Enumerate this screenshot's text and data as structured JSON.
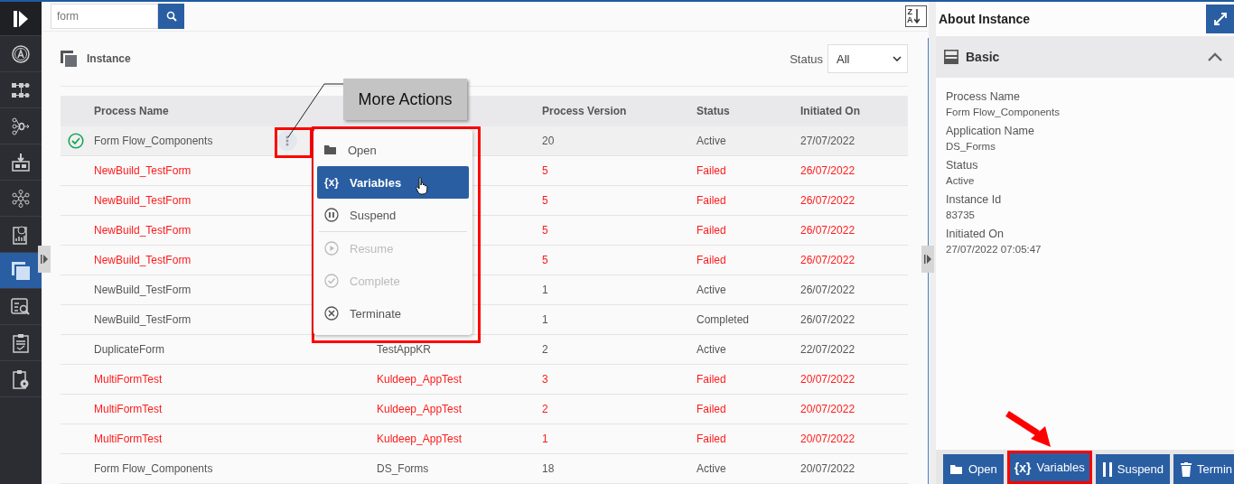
{
  "sidebar": {
    "items": [
      {
        "kind": "logo",
        "selected": false
      },
      {
        "kind": "apps",
        "selected": false
      },
      {
        "kind": "flow",
        "selected": false
      },
      {
        "kind": "branch",
        "selected": false
      },
      {
        "kind": "import",
        "selected": false
      },
      {
        "kind": "network",
        "selected": false
      },
      {
        "kind": "report",
        "selected": false
      },
      {
        "kind": "instance",
        "selected": true
      },
      {
        "kind": "audit",
        "selected": false
      },
      {
        "kind": "task",
        "selected": false
      },
      {
        "kind": "config",
        "selected": false
      }
    ]
  },
  "search": {
    "value": "form"
  },
  "sort_button": {
    "top": "Z",
    "bottom": "A"
  },
  "panel": {
    "title": "Instance",
    "status_label": "Status",
    "status_value": "All"
  },
  "table": {
    "columns": [
      "Process Name",
      null,
      "Process Version",
      "Status",
      "Initiated On"
    ],
    "rows": [
      {
        "selected": true,
        "failed": false,
        "cells": [
          "Form Flow_Components",
          null,
          "20",
          "Active",
          "27/07/2022"
        ]
      },
      {
        "selected": false,
        "failed": true,
        "cells": [
          "NewBuild_TestForm",
          null,
          "5",
          "Failed",
          "26/07/2022"
        ]
      },
      {
        "selected": false,
        "failed": true,
        "cells": [
          "NewBuild_TestForm",
          null,
          "5",
          "Failed",
          "26/07/2022"
        ]
      },
      {
        "selected": false,
        "failed": true,
        "cells": [
          "NewBuild_TestForm",
          null,
          "5",
          "Failed",
          "26/07/2022"
        ]
      },
      {
        "selected": false,
        "failed": true,
        "cells": [
          "NewBuild_TestForm",
          null,
          "5",
          "Failed",
          "26/07/2022"
        ]
      },
      {
        "selected": false,
        "failed": false,
        "cells": [
          "NewBuild_TestForm",
          null,
          "1",
          "Active",
          "26/07/2022"
        ]
      },
      {
        "selected": false,
        "failed": false,
        "cells": [
          "NewBuild_TestForm",
          null,
          "1",
          "Completed",
          "26/07/2022"
        ]
      },
      {
        "selected": false,
        "failed": false,
        "cells": [
          "DuplicateForm",
          "TestAppKR",
          "2",
          "Active",
          "22/07/2022"
        ]
      },
      {
        "selected": false,
        "failed": true,
        "cells": [
          "MultiFormTest",
          "Kuldeep_AppTest",
          "3",
          "Failed",
          "20/07/2022"
        ]
      },
      {
        "selected": false,
        "failed": true,
        "cells": [
          "MultiFormTest",
          "Kuldeep_AppTest",
          "2",
          "Failed",
          "20/07/2022"
        ]
      },
      {
        "selected": false,
        "failed": true,
        "cells": [
          "MultiFormTest",
          "Kuldeep_AppTest",
          "1",
          "Failed",
          "20/07/2022"
        ]
      },
      {
        "selected": false,
        "failed": false,
        "cells": [
          "Form Flow_Components",
          "DS_Forms",
          "18",
          "Active",
          "20/07/2022"
        ]
      }
    ]
  },
  "callout": "More Actions",
  "menu": {
    "items": [
      {
        "kind": "open",
        "label": "Open",
        "selected": false,
        "disabled": false
      },
      {
        "kind": "variables",
        "label": "Variables",
        "icon_text": "{x}",
        "selected": true,
        "disabled": false
      },
      {
        "kind": "suspend",
        "label": "Suspend",
        "selected": false,
        "disabled": false
      },
      {
        "kind": "divider"
      },
      {
        "kind": "resume",
        "label": "Resume",
        "selected": false,
        "disabled": true
      },
      {
        "kind": "complete",
        "label": "Complete",
        "selected": false,
        "disabled": true
      },
      {
        "kind": "terminate",
        "label": "Terminate",
        "selected": false,
        "disabled": false
      }
    ]
  },
  "details": {
    "title": "About Instance",
    "section": "Basic",
    "expanded": true,
    "fields": [
      {
        "label": "Process Name",
        "value": "Form Flow_Components"
      },
      {
        "label": "Application Name",
        "value": "DS_Forms"
      },
      {
        "label": "Status",
        "value": "Active"
      },
      {
        "label": "Instance Id",
        "value": "83735"
      },
      {
        "label": "Initiated On",
        "value": "27/07/2022 07:05:47"
      }
    ]
  },
  "actions": [
    {
      "kind": "open",
      "label": "Open",
      "annotated": false
    },
    {
      "kind": "variables",
      "label": "Variables",
      "icon_text": "{x}",
      "annotated": true
    },
    {
      "kind": "suspend",
      "label": "Suspend",
      "annotated": false
    },
    {
      "kind": "terminate",
      "label": "Termin",
      "annotated": false
    }
  ]
}
